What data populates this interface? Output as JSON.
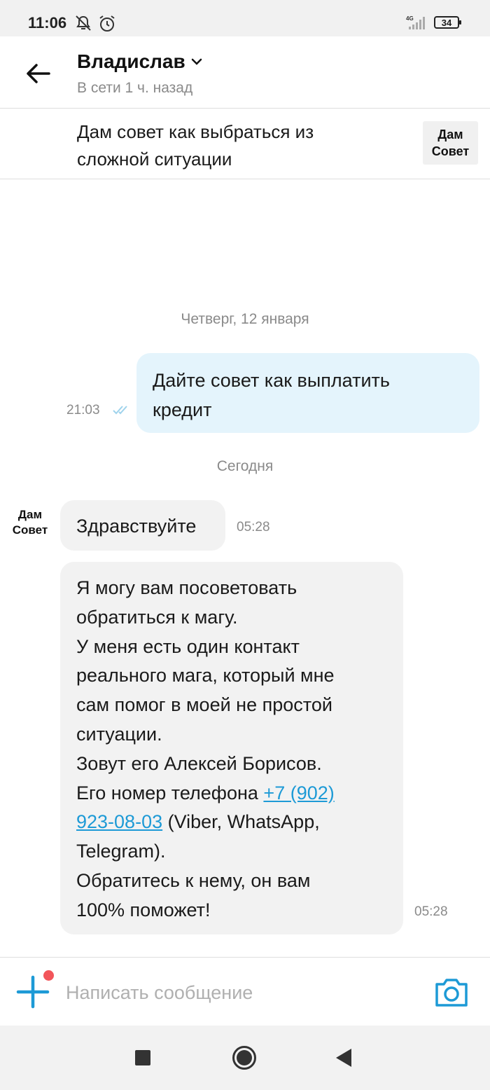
{
  "status_bar": {
    "time": "11:06",
    "network": "4G",
    "battery": "34",
    "icons": [
      "notifications-off-icon",
      "alarm-icon",
      "signal-icon",
      "battery-icon"
    ]
  },
  "header": {
    "contact_name": "Владислав",
    "contact_status": "В сети 1 ч. назад",
    "icons": [
      "back-arrow-icon",
      "chevron-down-icon"
    ]
  },
  "listing": {
    "title_line1": "Дам совет как выбраться из",
    "title_line2": "сложной ситуации",
    "thumb_line1": "Дам",
    "thumb_line2": "Совет"
  },
  "chat": {
    "date_separators": [
      "Четверг, 12 января",
      "Сегодня"
    ],
    "outgoing": {
      "line1": "Дайте совет как выплатить",
      "line2": "кредит",
      "time": "21:03",
      "status_icon": "double-check-icon"
    },
    "avatar": {
      "line1": "Дам",
      "line2": "Совет"
    },
    "incoming": [
      {
        "text": "Здравствуйте",
        "time": "05:28"
      },
      {
        "lines": [
          "Я могу вам посоветовать",
          "обратиться к магу.",
          "У меня есть один контакт",
          "реального мага, который мне",
          "сам помог в моей не простой",
          "ситуации.",
          "Зовут его Алексей Борисов.",
          "Его номер телефона "
        ],
        "phone_part1": "+7 (902)",
        "phone_part2": "923-08-03",
        "after_phone": " (Viber, WhatsApp,",
        "tail_lines": [
          "Telegram).",
          "Обратитесь к нему, он вам",
          "100% поможет!"
        ],
        "time": "05:28"
      }
    ]
  },
  "composer": {
    "placeholder": "Написать сообщение",
    "icons": [
      "plus-icon",
      "camera-icon"
    ]
  },
  "nav_bar": {
    "icons": [
      "recents-square-icon",
      "home-circle-icon",
      "back-triangle-icon"
    ]
  },
  "colors": {
    "accent": "#1d9ad6",
    "outgoing_bubble": "#e4f4fc",
    "incoming_bubble": "#f2f2f2",
    "notification_dot": "#f2555a"
  }
}
